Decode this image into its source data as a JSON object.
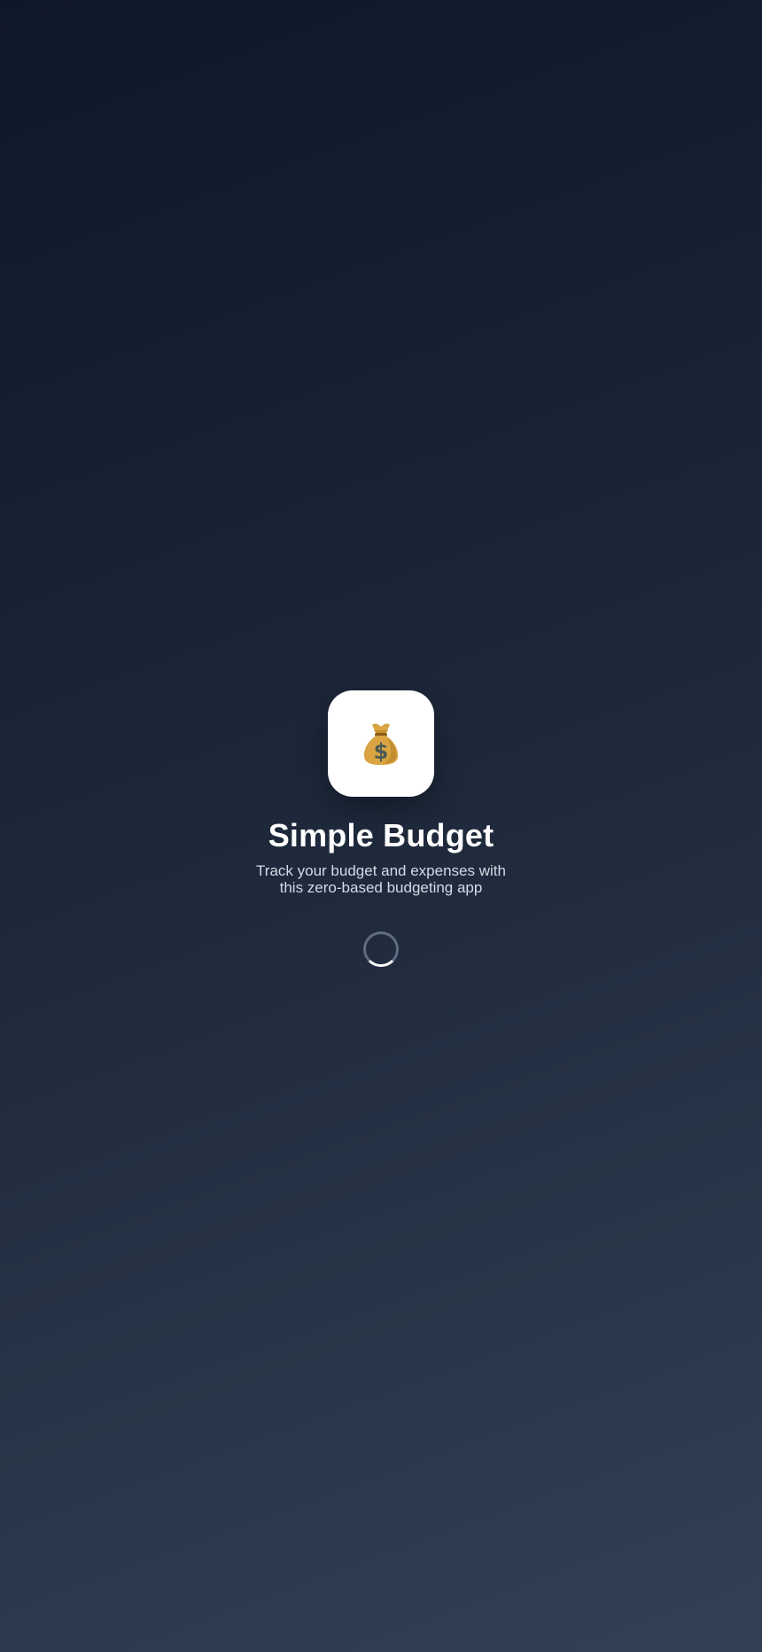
{
  "app": {
    "title": "Simple Budget",
    "tagline": "Track your budget and expenses with this zero-based budgeting app",
    "logo_icon": "money-bag-icon",
    "status": "loading-spinner"
  },
  "colors": {
    "background_start": "#0f172a",
    "background_end": "#334155",
    "logo_tile": "#ffffff",
    "bag": "#d9a441",
    "bag_shadow": "#b07a25",
    "dollar": "#4a5a52",
    "title_text": "#ffffff",
    "tagline_text": "#d4dbe5"
  }
}
